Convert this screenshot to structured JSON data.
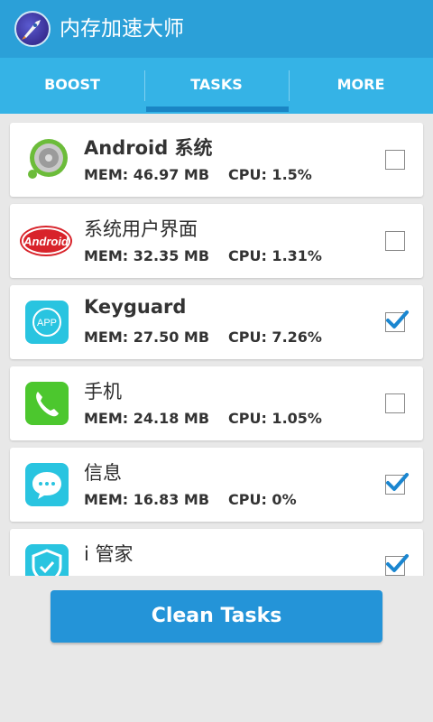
{
  "app": {
    "title": "内存加速大师"
  },
  "tabs": [
    {
      "label": "BOOST",
      "active": false
    },
    {
      "label": "TASKS",
      "active": true
    },
    {
      "label": "MORE",
      "active": false
    }
  ],
  "tasks": [
    {
      "name": "Android 系统",
      "mem": "MEM: 46.97 MB",
      "cpu": "CPU: 1.5%",
      "checked": false,
      "icon": "android-system-icon"
    },
    {
      "name": "系统用户界面",
      "mem": "MEM: 32.35 MB",
      "cpu": "CPU: 1.31%",
      "checked": false,
      "icon": "android-logo-icon"
    },
    {
      "name": "Keyguard",
      "mem": "MEM: 27.50 MB",
      "cpu": "CPU: 7.26%",
      "checked": true,
      "icon": "app-icon"
    },
    {
      "name": "手机",
      "mem": "MEM: 24.18 MB",
      "cpu": "CPU: 1.05%",
      "checked": false,
      "icon": "phone-icon"
    },
    {
      "name": "信息",
      "mem": "MEM: 16.83 MB",
      "cpu": "CPU: 0%",
      "checked": true,
      "icon": "message-icon"
    },
    {
      "name": "i 管家",
      "mem": "",
      "cpu": "",
      "checked": true,
      "icon": "shield-check-icon"
    }
  ],
  "clean_button": {
    "label": "Clean Tasks"
  },
  "colors": {
    "titlebar": "#2ba0d8",
    "tabbar": "#35b3e6",
    "accent": "#1a85c4",
    "button": "#2494d8",
    "check": "#1a86d0"
  }
}
